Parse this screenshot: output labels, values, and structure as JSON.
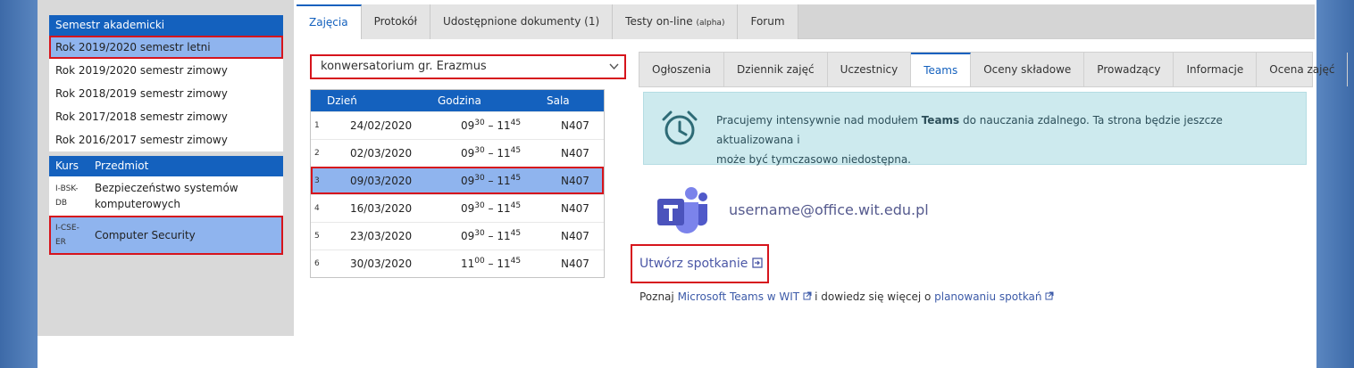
{
  "sidebar": {
    "semestr_header": "Semestr akademicki",
    "semesters": [
      {
        "label": "Rok 2019/2020 semestr letni"
      },
      {
        "label": "Rok 2019/2020 semestr zimowy"
      },
      {
        "label": "Rok 2018/2019 semestr zimowy"
      },
      {
        "label": "Rok 2017/2018 semestr zimowy"
      },
      {
        "label": "Rok 2016/2017 semestr zimowy"
      }
    ],
    "kurs_header": "Kurs",
    "przedmiot_header": "Przedmiot",
    "courses": [
      {
        "code_line1": "I-BSK-",
        "code_line2": "DB",
        "name_line1": "Bezpieczeństwo systemów",
        "name_line2": "komputerowych"
      },
      {
        "code_line1": "I-CSE-",
        "code_line2": "ER",
        "name_line1": "Computer Security",
        "name_line2": ""
      }
    ]
  },
  "top_tabs": [
    {
      "label": "Zajęcia"
    },
    {
      "label": "Protokół"
    },
    {
      "label": "Udostępnione dokumenty (1)"
    },
    {
      "label": "Testy on-line",
      "suffix": "(alpha)"
    },
    {
      "label": "Forum"
    }
  ],
  "group_select": {
    "value": "konwersatorium gr. Erazmus"
  },
  "schedule": {
    "headers": {
      "day": "Dzień",
      "hour": "Godzina",
      "room": "Sala"
    },
    "rows": [
      {
        "num": "1",
        "date": "24/02/2020",
        "start_h": "09",
        "start_m": "30",
        "sep": " – ",
        "end_h": "11",
        "end_m": "45",
        "room": "N407"
      },
      {
        "num": "2",
        "date": "02/03/2020",
        "start_h": "09",
        "start_m": "30",
        "sep": " – ",
        "end_h": "11",
        "end_m": "45",
        "room": "N407"
      },
      {
        "num": "3",
        "date": "09/03/2020",
        "start_h": "09",
        "start_m": "30",
        "sep": " – ",
        "end_h": "11",
        "end_m": "45",
        "room": "N407"
      },
      {
        "num": "4",
        "date": "16/03/2020",
        "start_h": "09",
        "start_m": "30",
        "sep": " – ",
        "end_h": "11",
        "end_m": "45",
        "room": "N407"
      },
      {
        "num": "5",
        "date": "23/03/2020",
        "start_h": "09",
        "start_m": "30",
        "sep": " – ",
        "end_h": "11",
        "end_m": "45",
        "room": "N407"
      },
      {
        "num": "6",
        "date": "30/03/2020",
        "start_h": "11",
        "start_m": "00",
        "sep": " – ",
        "end_h": "11",
        "end_m": "45",
        "room": "N407"
      }
    ]
  },
  "sub_tabs": [
    {
      "label": "Ogłoszenia"
    },
    {
      "label": "Dziennik zajęć"
    },
    {
      "label": "Uczestnicy"
    },
    {
      "label": "Teams"
    },
    {
      "label": "Oceny składowe"
    },
    {
      "label": "Prowadzący"
    },
    {
      "label": "Informacje"
    },
    {
      "label": "Ocena zajęć"
    }
  ],
  "info": {
    "line1_pre": "Pracujemy intensywnie nad modułem ",
    "line1_bold": "Teams",
    "line1_post": " do nauczania zdalnego. Ta strona będzie jeszcze aktualizowana i",
    "line2": "może być tymczasowo niedostępna."
  },
  "teams": {
    "username": "username@office.wit.edu.pl",
    "create_label": "Utwórz spotkanie",
    "learn_pre": "Poznaj ",
    "learn_link1": "Microsoft Teams w WIT",
    "learn_mid": " i dowiedz się więcej o ",
    "learn_link2": "planowaniu spotkań"
  },
  "icons": {
    "clock": "alarm-clock-icon",
    "teams": "microsoft-teams-logo",
    "external": "external-link-icon",
    "chevron": "chevron-down-icon"
  },
  "colors": {
    "accent": "#1461be",
    "selected": "#8fb4ee",
    "highlight_border": "#d6141c",
    "info_bg": "#cdeaee",
    "teams_purple": "#5059c9"
  }
}
